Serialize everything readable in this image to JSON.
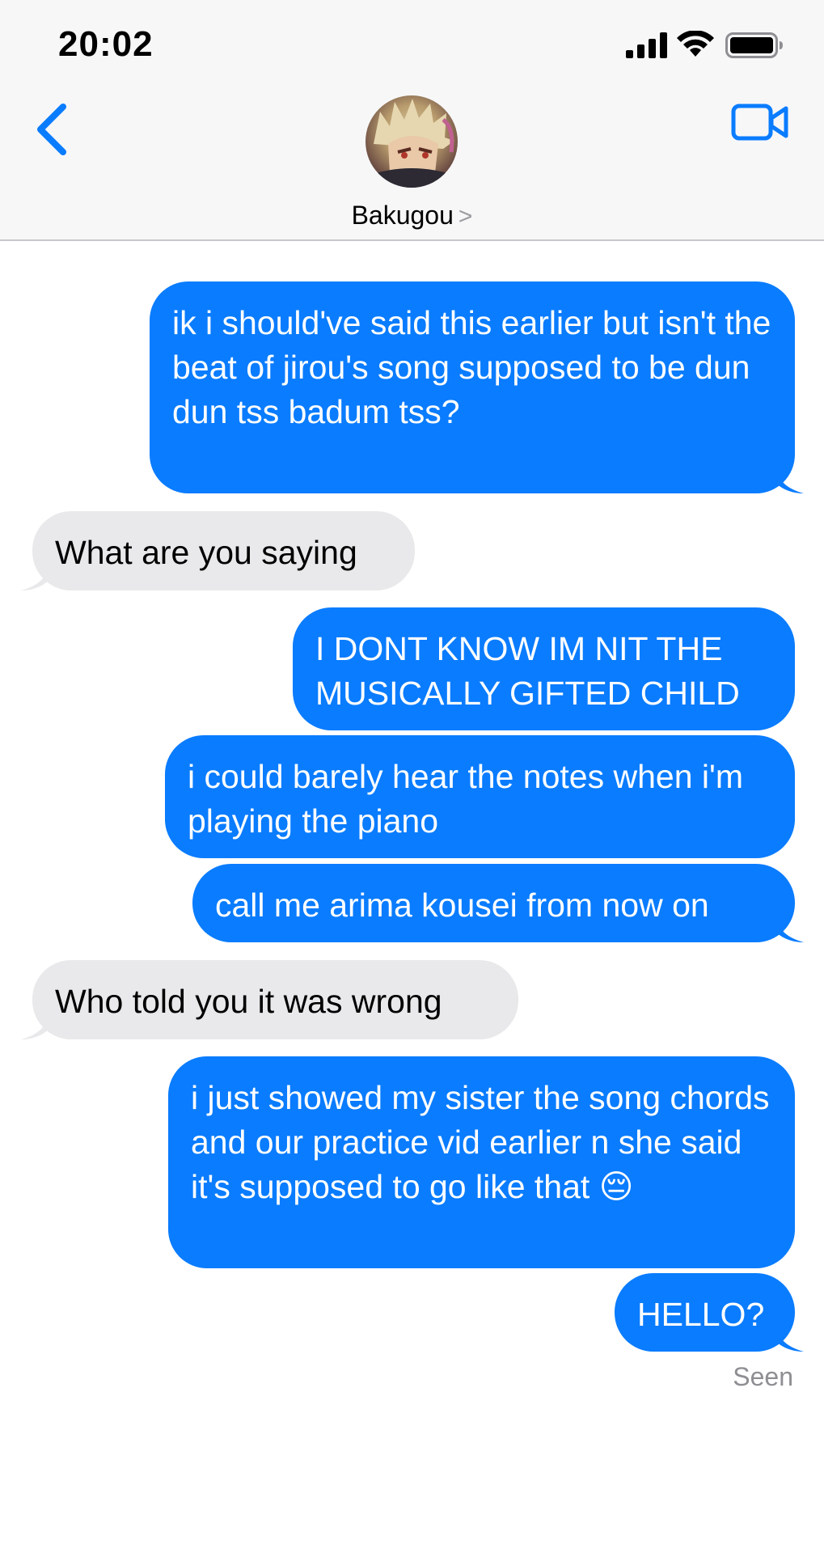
{
  "status_bar": {
    "time": "20:02"
  },
  "header": {
    "contact_name": "Bakugou",
    "name_chevron": ">",
    "back_icon": "chevron-left-icon",
    "video_icon": "video-camera-icon",
    "accent_color": "#0a7cff"
  },
  "messages": [
    {
      "direction": "sent",
      "text": "ik i should've said this earlier but isn't the beat of jirou's song supposed to be dun dun tss badum tss?"
    },
    {
      "direction": "received",
      "text": "What are you saying"
    },
    {
      "direction": "sent",
      "text": "I DONT KNOW IM NIT THE MUSICALLY GIFTED CHILD"
    },
    {
      "direction": "sent",
      "text": "i could barely hear the notes when i'm playing the piano"
    },
    {
      "direction": "sent",
      "text": "call me arima kousei from now on"
    },
    {
      "direction": "received",
      "text": "Who told you it was wrong"
    },
    {
      "direction": "sent",
      "text": "i just showed my sister the song chords and our practice vid earlier n she said it's supposed to go like that 😔"
    },
    {
      "direction": "sent",
      "text": "HELLO?"
    }
  ],
  "receipt": "Seen",
  "colors": {
    "sent_bubble": "#0a7cff",
    "received_bubble": "#e9e9eb",
    "header_bg": "#f7f7f8"
  }
}
